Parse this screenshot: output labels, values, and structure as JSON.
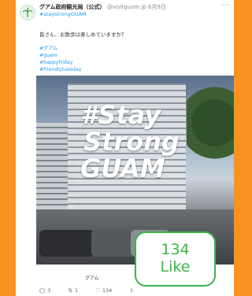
{
  "tweet": {
    "author_name": "グアム政府観光局（公式）",
    "handle": "@visitguam.jp",
    "date": "6月9日",
    "sub_hashtag": "#staystrongGUAM",
    "body": "皆さん、お散歩は楽しめていますか？",
    "hashtags": [
      "#グアム",
      "#guam",
      "#happyfriday",
      "#friendlytuesday"
    ],
    "photo_caption": "グアム",
    "actions": {
      "reply_count": "3",
      "retweet_count": "1",
      "like_count": "134",
      "share_label": ""
    }
  },
  "photo": {
    "overlay_line1": "#Stay",
    "overlay_line2": "Strong",
    "overlay_line3": "GUAM"
  },
  "like_badge": {
    "count": "134",
    "label": "Like"
  },
  "colors": {
    "background": "#f7931e",
    "accent": "#39b54a",
    "link": "#1d9bf0"
  }
}
